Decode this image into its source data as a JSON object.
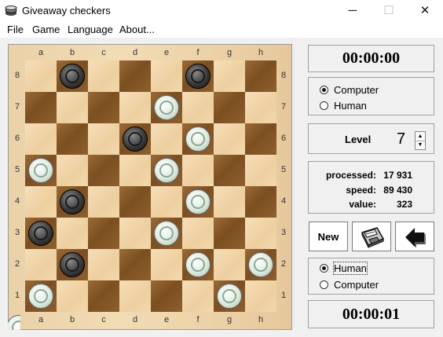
{
  "window": {
    "title": "Giveaway checkers",
    "minimize_glyph": "─",
    "maximize_glyph": "☐",
    "close_glyph": "✕"
  },
  "menu": [
    "File",
    "Game",
    "Language",
    "About..."
  ],
  "board": {
    "files": [
      "a",
      "b",
      "c",
      "d",
      "e",
      "f",
      "g",
      "h"
    ],
    "ranks": [
      "8",
      "7",
      "6",
      "5",
      "4",
      "3",
      "2",
      "1"
    ],
    "pieces": [
      {
        "square": "b8",
        "color": "black"
      },
      {
        "square": "f8",
        "color": "black"
      },
      {
        "square": "e7",
        "color": "white"
      },
      {
        "square": "d6",
        "color": "black"
      },
      {
        "square": "f6",
        "color": "white"
      },
      {
        "square": "a5",
        "color": "white"
      },
      {
        "square": "e5",
        "color": "white"
      },
      {
        "square": "b4",
        "color": "black"
      },
      {
        "square": "f4",
        "color": "white"
      },
      {
        "square": "a3",
        "color": "black"
      },
      {
        "square": "e3",
        "color": "white"
      },
      {
        "square": "b2",
        "color": "black"
      },
      {
        "square": "f2",
        "color": "white"
      },
      {
        "square": "h2",
        "color": "white"
      },
      {
        "square": "a1",
        "color": "white"
      },
      {
        "square": "g1",
        "color": "white"
      }
    ],
    "captured_white_partial_count": 1
  },
  "top_player": {
    "timer": "00:00:00",
    "options": [
      "Computer",
      "Human"
    ],
    "selected": "Computer"
  },
  "level": {
    "label": "Level",
    "value": "7"
  },
  "stats": {
    "processed_label": "processed:",
    "processed_value": "17 931",
    "speed_label": "speed:",
    "speed_value": "89 430",
    "value_label": "value:",
    "value_value": "323"
  },
  "buttons": {
    "new_label": "New",
    "save_icon": "floppy-disk-icon",
    "undo_icon": "back-arrow-icon"
  },
  "bottom_player": {
    "options": [
      "Human",
      "Computer"
    ],
    "selected": "Human",
    "timer": "00:00:01"
  }
}
